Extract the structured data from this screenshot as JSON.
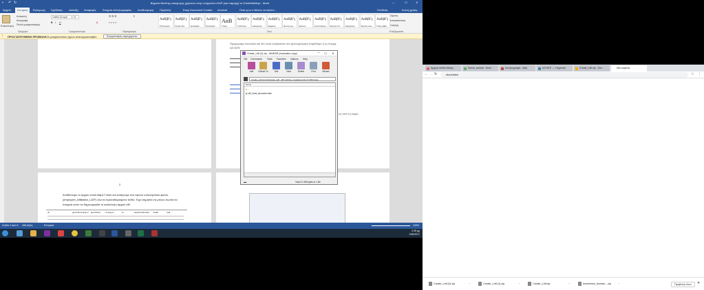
{
  "word": {
    "title": "Βήματα Μελέτης εισαγωγής χρηστών στην υπηρεσία LDAP (και παροχή) το Οπισθοδόθησ - Word",
    "signin": "Σύνδεση",
    "share": "Κοινή χρήση",
    "tabs": [
      "Αρχείο",
      "Κεντρική",
      "Εισαγωγή",
      "Σχεδίαση",
      "Διάταξη",
      "Αναφορές",
      "Στοιχεία αλληλογραφίας",
      "Αναθεώρηση",
      "Προβολή",
      "Easy Document Creator",
      "Acrobat",
      "Πείτε μου τι θέλετε να κάνετε..."
    ],
    "ribbon": {
      "paste_label": "Επικόλληση",
      "cut": "Αποκοπή",
      "copy": "Αντιγραφή",
      "format_painter": "Πινέλο μορφοποίησης",
      "font_name": "Calibri (Σώμα)",
      "font_size": "11",
      "groups": [
        "Πρόχειρο",
        "Γραμματοσειρά",
        "Παράγραφος",
        "Στυλ",
        "Επεξεργασία"
      ],
      "styles": [
        {
          "sample": "AαBβΓγ",
          "name": "¶ Κανονικό"
        },
        {
          "sample": "AαBβΓγ",
          "name": "Χωρίς διά..."
        },
        {
          "sample": "AαBβΓγ",
          "name": "Επικεφαλ..."
        },
        {
          "sample": "AαBβΓγ",
          "name": "Επικεφαλ..."
        },
        {
          "sample": "AαΒ",
          "name": "Τίτλος"
        },
        {
          "sample": "AαBβΓγ",
          "name": "Υπότιτλος"
        },
        {
          "sample": "AαBβΓγ",
          "name": "Διακριτική..."
        },
        {
          "sample": "AαBβΓγ",
          "name": "Έμφαση"
        },
        {
          "sample": "AαBβΓγ",
          "name": "Έντονη έμ..."
        },
        {
          "sample": "AαBβΓγ",
          "name": "Έντονο"
        },
        {
          "sample": "AαBβΓγ",
          "name": "Απόσπασμα"
        },
        {
          "sample": "AαBβΓγ",
          "name": "Έντονο απ..."
        },
        {
          "sample": "AαBβΓγ",
          "name": "Διακριτική..."
        },
        {
          "sample": "AαBβΓγ",
          "name": "Έντονη ανα..."
        },
        {
          "sample": "AαBβΓγ",
          "name": "Τίτλος βιβλ..."
        }
      ],
      "find": "Εύρεση",
      "replace": "Αντικατάσταση",
      "select": "Επιλογή"
    },
    "warning": {
      "title": "ΠΡΟΣΤΑΤΕΥΜΕΝΗ ΠΡΟΒΟΛΗ",
      "text": "Οι μακροεντολές έχουν απενεργοποιηθεί.",
      "button": "Ενεργοποίηση περιεχομένου"
    },
    "doc": {
      "p1": "Αναθέτουμε το αρχείο excel  ldap17.xlsm  και εισάγουμε στο πρώτο υπολογιστικό φύλλο",
      "p2": "(employee_Affiliation_LDIF) όλα τα προσαθορισμένα πεδία. Έχει σημασία να μπουν σωστά τα",
      "p3": "στοιχεία ώστε να δημιουργηθεί το κατάλληλο αρχείο ldif.",
      "p4": "Προχωράμε κανονικά και δεν είναι ανάγκαστο στο φυλλομετρητή παράθυρο ή τη στιγμή,",
      "p5": "ΑΣΥΑΤΕ",
      "p6": "τις από τη κύρια",
      "page_num": "2",
      "table_headers": [
        "dn",
        "givenName;lang-el",
        "givenName",
        "sn;lang-el",
        "sn",
        "telephoneNumber",
        "mobile",
        "mail"
      ]
    },
    "status": {
      "page": "Σελίδα 2 από 6",
      "words": "406 λέξεις",
      "lang": "Ελληνικά",
      "zoom": "100%"
    }
  },
  "winrar": {
    "title": "Create_Ldif (2).zip - WinRAR (evaluation copy)",
    "menu": [
      "File",
      "Commands",
      "Tools",
      "Favorites",
      "Options",
      "Help"
    ],
    "tools": [
      "Add",
      "Extract To",
      "Test",
      "View",
      "Delete",
      "Find",
      "Wizard"
    ],
    "path": "Create_Ldif (2).zip\\Create_Ldif - ZIP archive, unpacked size 47.383 bytes",
    "column": "Name",
    "rows": [
      "..",
      "Ldif_local_accounts.xlsm"
    ],
    "status": "Total 47.383 bytes in 1 file"
  },
  "taskbar": {
    "time": "2:35 μμ",
    "date": "13/6/2017"
  },
  "chrome": {
    "tabs": [
      "Αρχική σελίδα Μέσης",
      "Sendo_tutorial - Omni",
      "Αλληλογραφία - ektp",
      "ΑΣΥΑΤΕ — Υπηρεσία",
      "Create_Ldif.zip - Goo",
      "Νέα καρτέλα"
    ],
    "url": "about:blank",
    "downloads": [
      "Create_Ldif (2).zip",
      "Create_Ldif (1).zip",
      "Create_Ldif.zip",
      "homebrew_browse....zip"
    ],
    "show_all": "Προβολή όλων"
  }
}
